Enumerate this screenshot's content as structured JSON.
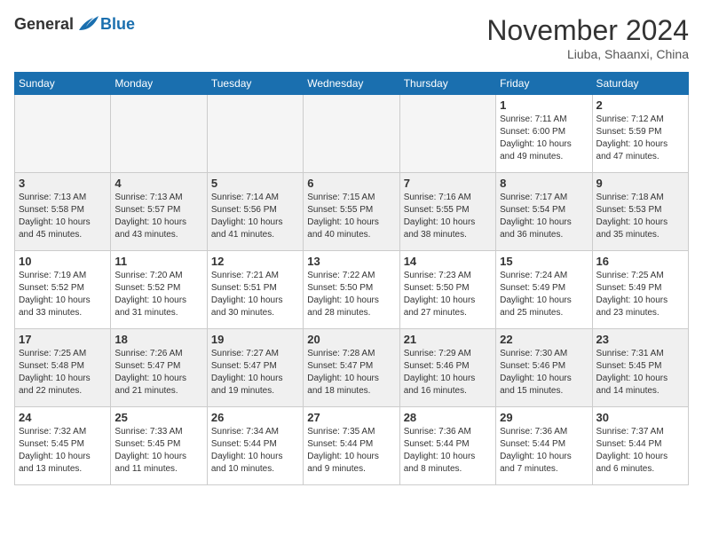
{
  "header": {
    "logo_general": "General",
    "logo_blue": "Blue",
    "month_title": "November 2024",
    "location": "Liuba, Shaanxi, China"
  },
  "days_of_week": [
    "Sunday",
    "Monday",
    "Tuesday",
    "Wednesday",
    "Thursday",
    "Friday",
    "Saturday"
  ],
  "weeks": [
    [
      {
        "day": "",
        "info": ""
      },
      {
        "day": "",
        "info": ""
      },
      {
        "day": "",
        "info": ""
      },
      {
        "day": "",
        "info": ""
      },
      {
        "day": "",
        "info": ""
      },
      {
        "day": "1",
        "info": "Sunrise: 7:11 AM\nSunset: 6:00 PM\nDaylight: 10 hours and 49 minutes."
      },
      {
        "day": "2",
        "info": "Sunrise: 7:12 AM\nSunset: 5:59 PM\nDaylight: 10 hours and 47 minutes."
      }
    ],
    [
      {
        "day": "3",
        "info": "Sunrise: 7:13 AM\nSunset: 5:58 PM\nDaylight: 10 hours and 45 minutes."
      },
      {
        "day": "4",
        "info": "Sunrise: 7:13 AM\nSunset: 5:57 PM\nDaylight: 10 hours and 43 minutes."
      },
      {
        "day": "5",
        "info": "Sunrise: 7:14 AM\nSunset: 5:56 PM\nDaylight: 10 hours and 41 minutes."
      },
      {
        "day": "6",
        "info": "Sunrise: 7:15 AM\nSunset: 5:55 PM\nDaylight: 10 hours and 40 minutes."
      },
      {
        "day": "7",
        "info": "Sunrise: 7:16 AM\nSunset: 5:55 PM\nDaylight: 10 hours and 38 minutes."
      },
      {
        "day": "8",
        "info": "Sunrise: 7:17 AM\nSunset: 5:54 PM\nDaylight: 10 hours and 36 minutes."
      },
      {
        "day": "9",
        "info": "Sunrise: 7:18 AM\nSunset: 5:53 PM\nDaylight: 10 hours and 35 minutes."
      }
    ],
    [
      {
        "day": "10",
        "info": "Sunrise: 7:19 AM\nSunset: 5:52 PM\nDaylight: 10 hours and 33 minutes."
      },
      {
        "day": "11",
        "info": "Sunrise: 7:20 AM\nSunset: 5:52 PM\nDaylight: 10 hours and 31 minutes."
      },
      {
        "day": "12",
        "info": "Sunrise: 7:21 AM\nSunset: 5:51 PM\nDaylight: 10 hours and 30 minutes."
      },
      {
        "day": "13",
        "info": "Sunrise: 7:22 AM\nSunset: 5:50 PM\nDaylight: 10 hours and 28 minutes."
      },
      {
        "day": "14",
        "info": "Sunrise: 7:23 AM\nSunset: 5:50 PM\nDaylight: 10 hours and 27 minutes."
      },
      {
        "day": "15",
        "info": "Sunrise: 7:24 AM\nSunset: 5:49 PM\nDaylight: 10 hours and 25 minutes."
      },
      {
        "day": "16",
        "info": "Sunrise: 7:25 AM\nSunset: 5:49 PM\nDaylight: 10 hours and 23 minutes."
      }
    ],
    [
      {
        "day": "17",
        "info": "Sunrise: 7:25 AM\nSunset: 5:48 PM\nDaylight: 10 hours and 22 minutes."
      },
      {
        "day": "18",
        "info": "Sunrise: 7:26 AM\nSunset: 5:47 PM\nDaylight: 10 hours and 21 minutes."
      },
      {
        "day": "19",
        "info": "Sunrise: 7:27 AM\nSunset: 5:47 PM\nDaylight: 10 hours and 19 minutes."
      },
      {
        "day": "20",
        "info": "Sunrise: 7:28 AM\nSunset: 5:47 PM\nDaylight: 10 hours and 18 minutes."
      },
      {
        "day": "21",
        "info": "Sunrise: 7:29 AM\nSunset: 5:46 PM\nDaylight: 10 hours and 16 minutes."
      },
      {
        "day": "22",
        "info": "Sunrise: 7:30 AM\nSunset: 5:46 PM\nDaylight: 10 hours and 15 minutes."
      },
      {
        "day": "23",
        "info": "Sunrise: 7:31 AM\nSunset: 5:45 PM\nDaylight: 10 hours and 14 minutes."
      }
    ],
    [
      {
        "day": "24",
        "info": "Sunrise: 7:32 AM\nSunset: 5:45 PM\nDaylight: 10 hours and 13 minutes."
      },
      {
        "day": "25",
        "info": "Sunrise: 7:33 AM\nSunset: 5:45 PM\nDaylight: 10 hours and 11 minutes."
      },
      {
        "day": "26",
        "info": "Sunrise: 7:34 AM\nSunset: 5:44 PM\nDaylight: 10 hours and 10 minutes."
      },
      {
        "day": "27",
        "info": "Sunrise: 7:35 AM\nSunset: 5:44 PM\nDaylight: 10 hours and 9 minutes."
      },
      {
        "day": "28",
        "info": "Sunrise: 7:36 AM\nSunset: 5:44 PM\nDaylight: 10 hours and 8 minutes."
      },
      {
        "day": "29",
        "info": "Sunrise: 7:36 AM\nSunset: 5:44 PM\nDaylight: 10 hours and 7 minutes."
      },
      {
        "day": "30",
        "info": "Sunrise: 7:37 AM\nSunset: 5:44 PM\nDaylight: 10 hours and 6 minutes."
      }
    ]
  ]
}
